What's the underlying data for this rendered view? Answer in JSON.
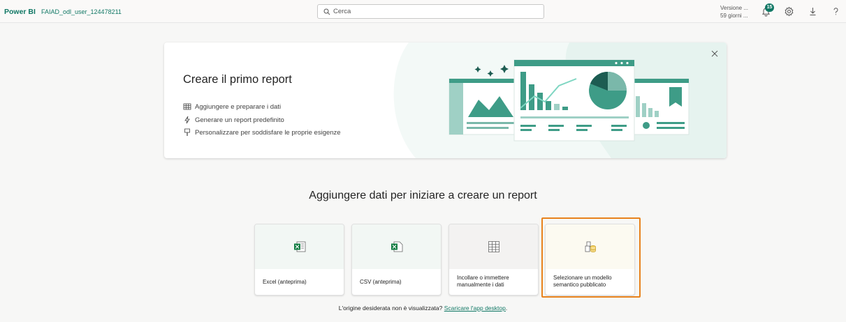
{
  "header": {
    "brand": "Power BI",
    "workspace": "FAIAD_odl_user_124478211",
    "search_placeholder": "Cerca",
    "trial_line1": "Versione ...",
    "trial_line2": "59 giorni ...",
    "notification_count": "15"
  },
  "banner": {
    "title": "Creare il primo report",
    "features": [
      "Aggiungere e preparare i dati",
      "Generare un report predefinito",
      "Personalizzare per soddisfare le proprie esigenze"
    ]
  },
  "main": {
    "heading": "Aggiungere dati per iniziare a creare un report",
    "cards": [
      {
        "label": "Excel (anteprima)",
        "icon": "excel-icon"
      },
      {
        "label": "CSV (anteprima)",
        "icon": "csv-icon"
      },
      {
        "label": "Incollare o immettere manualmente i dati",
        "icon": "table-grid-icon"
      },
      {
        "label": "Selezionare un modello semantico pubblicato",
        "icon": "semantic-model-icon"
      }
    ],
    "footer_text": "L'origine desiderata non è visualizzata?",
    "footer_link": "Scaricare l'app desktop",
    "footer_end": "."
  },
  "colors": {
    "accent": "#117865",
    "highlight": "#e8821c"
  }
}
